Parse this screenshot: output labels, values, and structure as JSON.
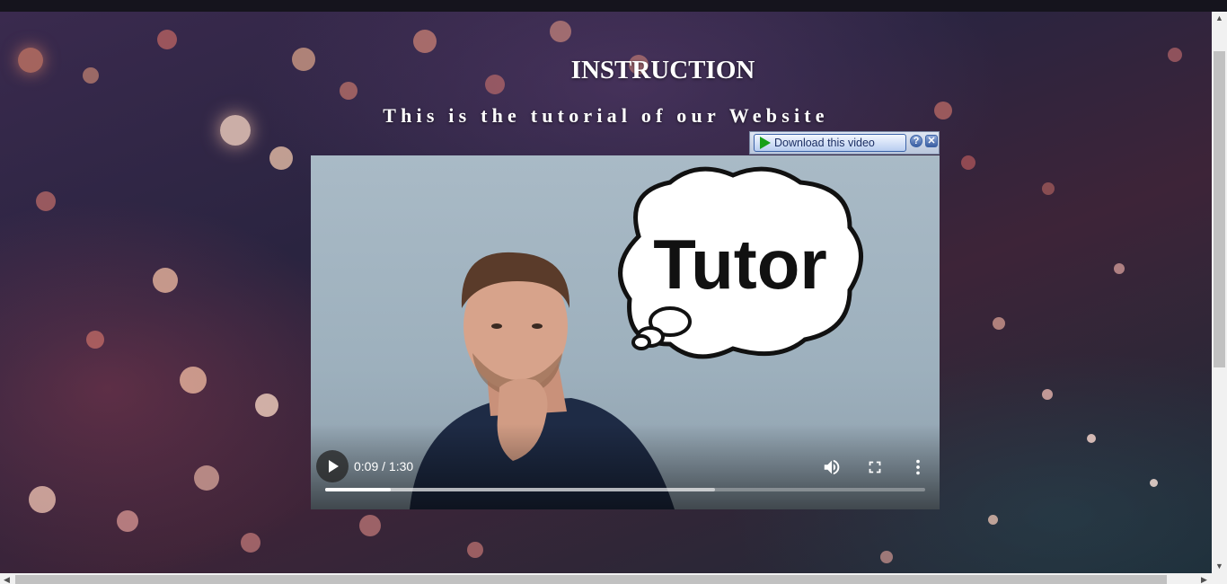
{
  "page": {
    "title": "INSTRUCTION",
    "subtitle": "This is the tutorial of our Website"
  },
  "download_bar": {
    "label": "Download this video",
    "help_label": "?",
    "close_label": "✕"
  },
  "video": {
    "thumbnail_text": "Tutor",
    "time_display": "0:09 / 1:30",
    "progress_played": 0.11,
    "progress_buffered": 0.65
  },
  "icons": {
    "play": "play-icon",
    "volume": "volume-icon",
    "fullscreen": "fullscreen-icon",
    "more": "more-options-icon"
  },
  "colors": {
    "background_dark": "#140f1e",
    "video_wall": "#a9bac6",
    "download_button_text": "#1c2f63"
  }
}
